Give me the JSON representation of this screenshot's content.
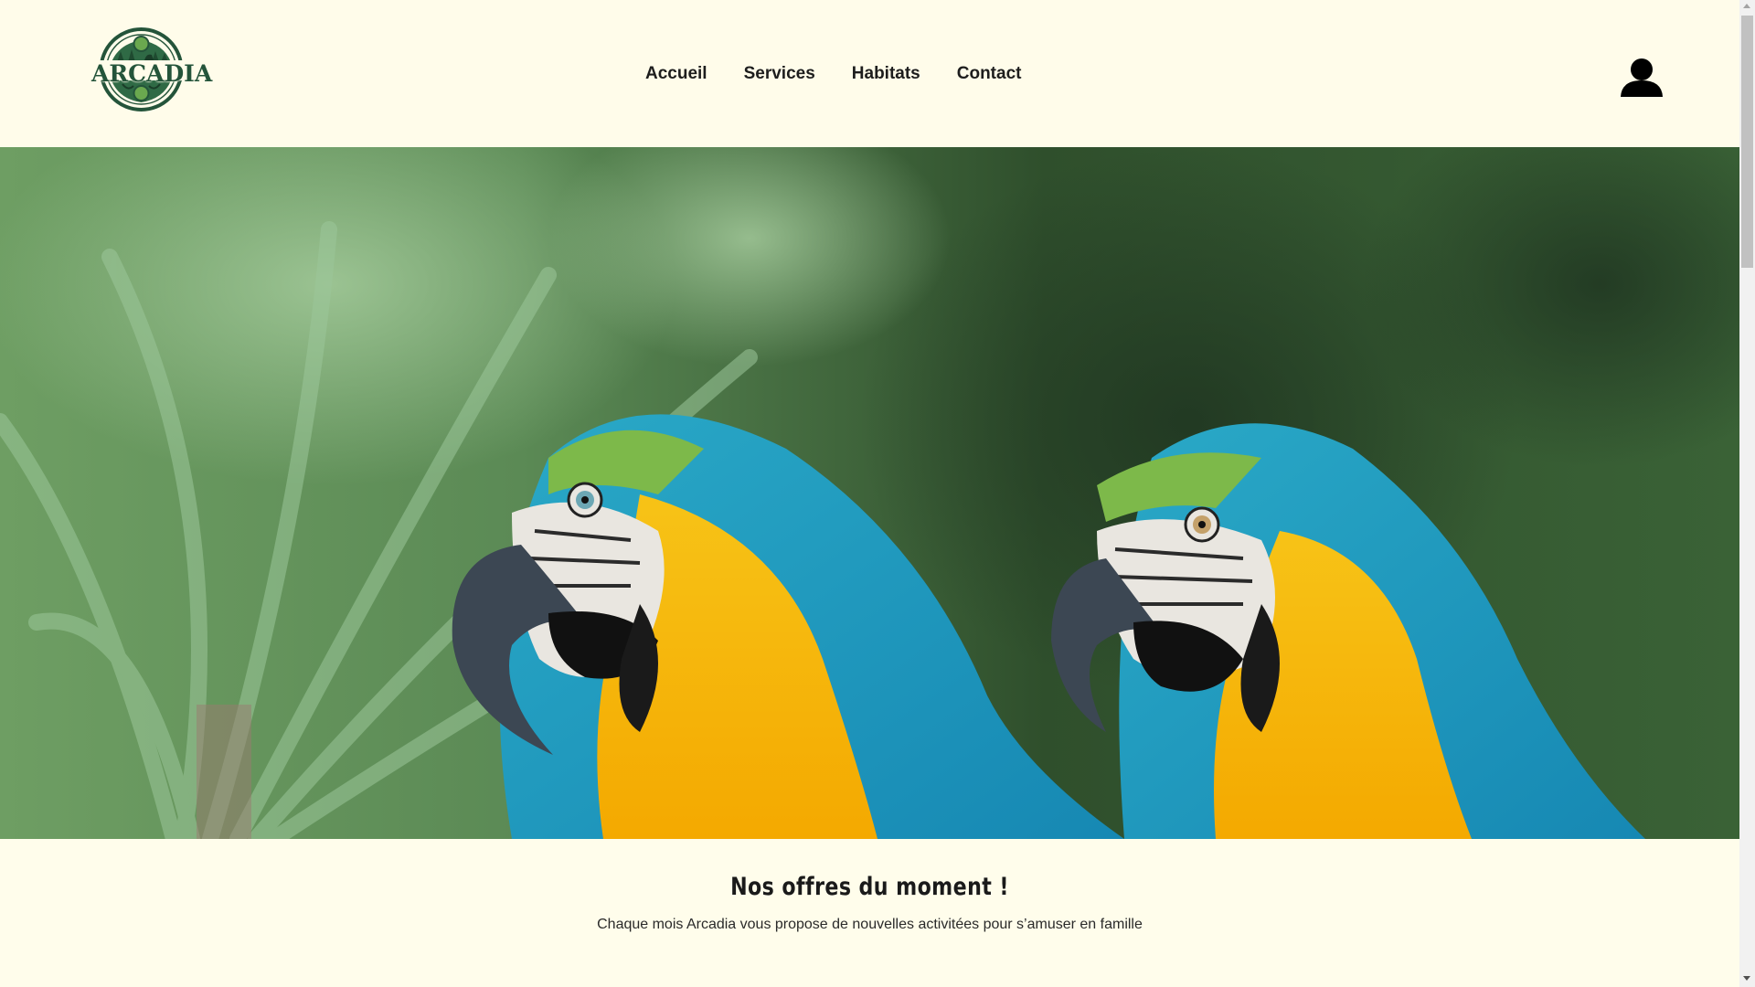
{
  "brand": {
    "logo_text": "ARCADIA"
  },
  "nav": {
    "items": [
      {
        "label": "Accueil"
      },
      {
        "label": "Services"
      },
      {
        "label": "Habitats"
      },
      {
        "label": "Contact"
      }
    ]
  },
  "user": {
    "icon": "user-icon"
  },
  "hero": {
    "image": "hero-image-two-macaws"
  },
  "offers": {
    "title": "Nos offres du moment !",
    "subtitle": "Chaque mois Arcadia vous propose de nouvelles activitées pour s’amuser en famille"
  },
  "colors": {
    "background": "#fffdeb",
    "brand_green": "#24543a",
    "text": "#1d1d1d"
  }
}
